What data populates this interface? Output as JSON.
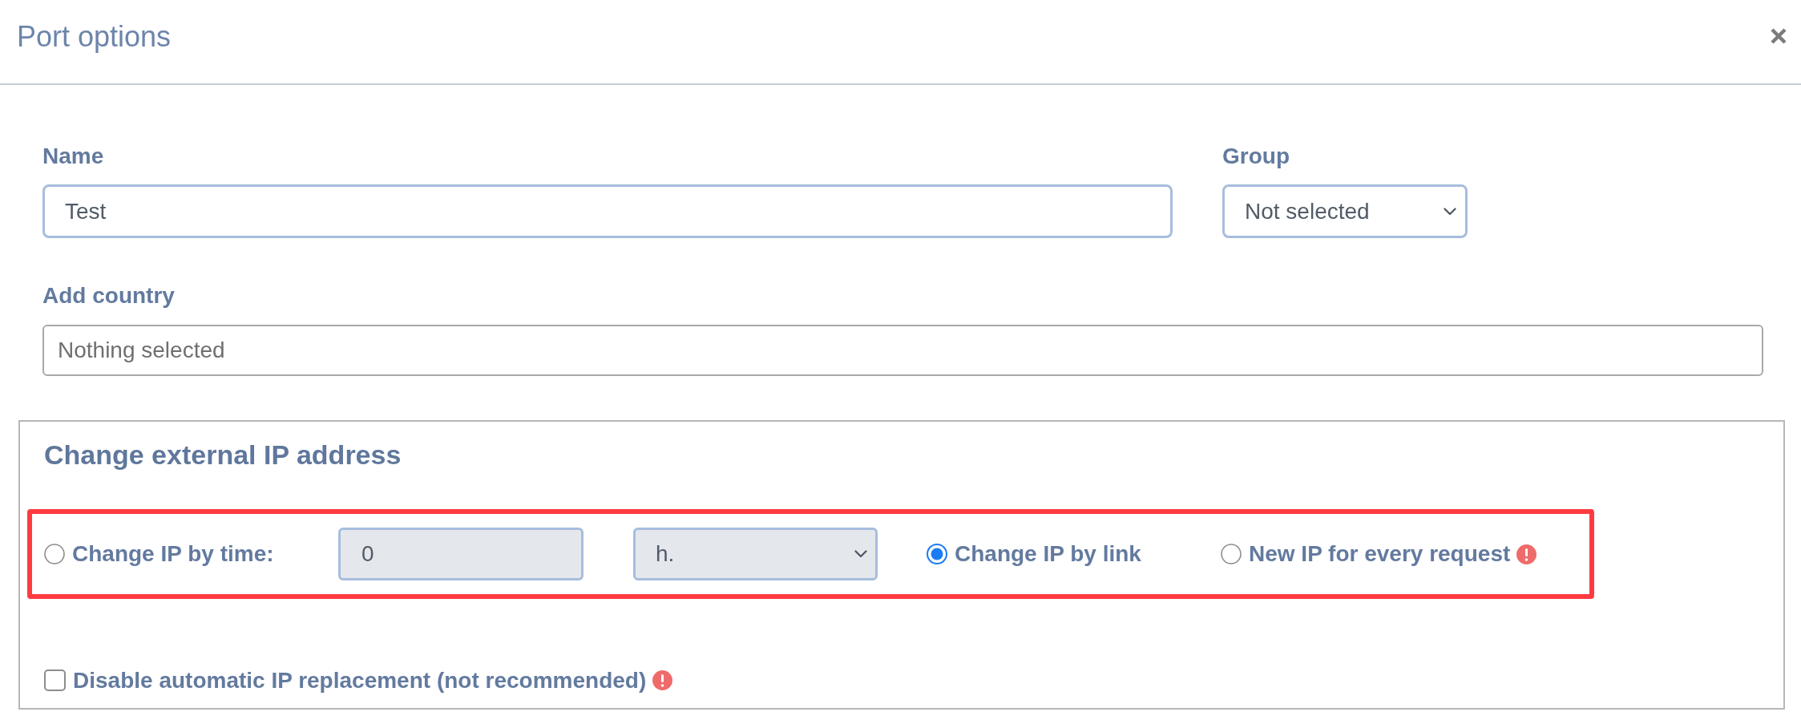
{
  "dialog": {
    "title": "Port options"
  },
  "name_field": {
    "label": "Name",
    "value": "Test"
  },
  "group_field": {
    "label": "Group",
    "value": "Not selected"
  },
  "country_field": {
    "label": "Add country",
    "placeholder": "Nothing selected"
  },
  "ip_section": {
    "title": "Change external IP address",
    "highlighted": true,
    "options": [
      {
        "kind": "timed",
        "label": "Change IP by time:",
        "selected": false,
        "warning": false,
        "interval": {
          "value": "0",
          "disabled": true
        },
        "unit": {
          "value": "h.",
          "disabled": true
        }
      },
      {
        "kind": "plain",
        "label": "Change IP by link",
        "selected": true,
        "warning": false
      },
      {
        "kind": "plain",
        "label": "New IP for every request",
        "selected": false,
        "warning": true
      }
    ],
    "auto_replace": {
      "label": "Disable automatic IP replacement (not recommended)",
      "checked": false,
      "warning": true
    }
  }
}
